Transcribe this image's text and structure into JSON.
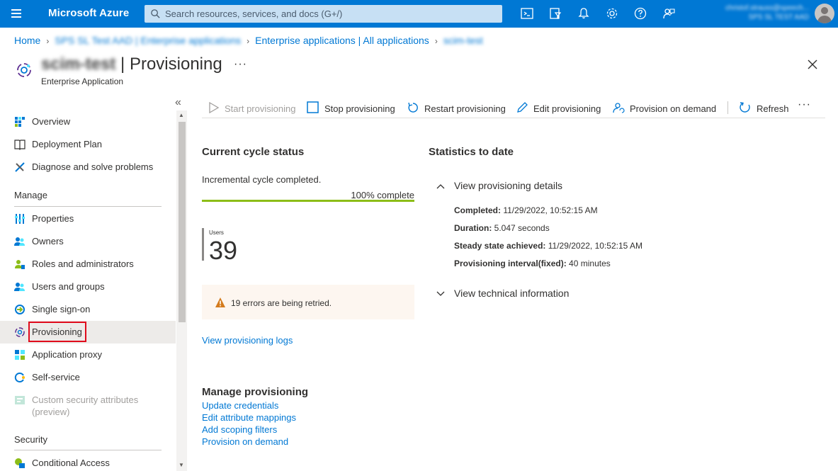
{
  "topbar": {
    "brand": "Microsoft Azure",
    "search_placeholder": "Search resources, services, and docs (G+/)",
    "account_line1": "christof.strauss@speech...",
    "account_line2": "SPS SL TEST AAD",
    "icons": [
      "cloud-shell-icon",
      "directory-filter-icon",
      "notifications-icon",
      "settings-icon",
      "help-icon",
      "feedback-icon"
    ],
    "accent": "#0078d4"
  },
  "breadcrumb": {
    "items": [
      "Home",
      "SPS SL Test AAD | Enterprise applications",
      "Enterprise applications | All applications",
      "scim-test"
    ]
  },
  "header": {
    "app_name": "scim-test",
    "separator": " | ",
    "title": "Provisioning",
    "subtitle": "Enterprise Application",
    "more": "···"
  },
  "sidebar": {
    "collapse": "«",
    "items": [
      {
        "label": "Overview",
        "icon": "overview-icon"
      },
      {
        "label": "Deployment Plan",
        "icon": "book-icon"
      },
      {
        "label": "Diagnose and solve problems",
        "icon": "wrench-icon"
      }
    ],
    "manage_label": "Manage",
    "manage_items": [
      {
        "label": "Properties",
        "icon": "properties-icon"
      },
      {
        "label": "Owners",
        "icon": "owners-icon"
      },
      {
        "label": "Roles and administrators",
        "icon": "roles-icon"
      },
      {
        "label": "Users and groups",
        "icon": "users-groups-icon"
      },
      {
        "label": "Single sign-on",
        "icon": "sso-icon"
      },
      {
        "label": "Provisioning",
        "icon": "provisioning-icon"
      },
      {
        "label": "Application proxy",
        "icon": "app-proxy-icon"
      },
      {
        "label": "Self-service",
        "icon": "self-service-icon"
      },
      {
        "label": "Custom security attributes",
        "label2": "(preview)",
        "icon": "custom-attributes-icon"
      }
    ],
    "security_label": "Security",
    "security_items": [
      {
        "label": "Conditional Access",
        "icon": "conditional-access-icon"
      }
    ]
  },
  "toolbar": {
    "start": "Start provisioning",
    "stop": "Stop provisioning",
    "restart": "Restart provisioning",
    "edit": "Edit provisioning",
    "on_demand": "Provision on demand",
    "refresh": "Refresh",
    "more": "···"
  },
  "current_cycle": {
    "heading": "Current cycle status",
    "status": "Incremental cycle completed.",
    "progress_label": "100% complete",
    "progress": 1.0,
    "progress_color": "#8cbd18",
    "users_label": "Users",
    "users_count": "39",
    "warning": "19 errors are being retried.",
    "logs_link": "View provisioning logs"
  },
  "statistics": {
    "heading": "Statistics to date",
    "details_toggle": "View provisioning details",
    "completed_label": "Completed:",
    "completed_value": "11/29/2022, 10:52:15 AM",
    "duration_label": "Duration:",
    "duration_value": "5.047 seconds",
    "steady_label": "Steady state achieved:",
    "steady_value": "11/29/2022, 10:52:15 AM",
    "interval_label": "Provisioning interval(fixed):",
    "interval_value": "40 minutes",
    "tech_toggle": "View technical information"
  },
  "manage_provisioning": {
    "heading": "Manage provisioning",
    "links": [
      "Update credentials",
      "Edit attribute mappings",
      "Add scoping filters",
      "Provision on demand"
    ]
  }
}
